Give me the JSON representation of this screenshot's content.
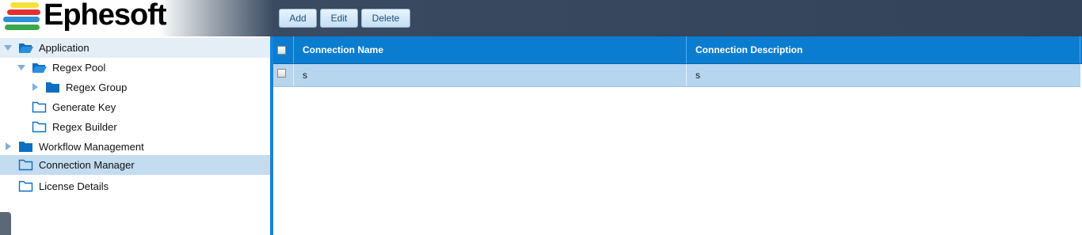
{
  "header": {
    "logo_text": "Ephesoft",
    "toolbar": {
      "add_label": "Add",
      "edit_label": "Edit",
      "delete_label": "Delete"
    }
  },
  "sidebar": {
    "items": [
      {
        "label": "Application",
        "icon": "folder-open-icon",
        "expanded": true
      },
      {
        "label": "Regex Pool",
        "icon": "folder-open-icon",
        "expanded": true
      },
      {
        "label": "Regex Group",
        "icon": "folder-filled-icon",
        "expanded": false
      },
      {
        "label": "Generate Key",
        "icon": "folder-outline-icon"
      },
      {
        "label": "Regex Builder",
        "icon": "folder-outline-icon"
      },
      {
        "label": "Workflow Management",
        "icon": "folder-filled-icon",
        "expanded": false
      },
      {
        "label": "Connection Manager",
        "icon": "folder-outline-icon",
        "selected": true
      },
      {
        "label": "License Details",
        "icon": "folder-outline-icon"
      }
    ]
  },
  "grid": {
    "columns": [
      "Connection Name",
      "Connection Description"
    ],
    "rows": [
      {
        "name": "s",
        "description": "s"
      }
    ]
  },
  "colors": {
    "header_dark": "#33435a",
    "grid_header": "#0a7dd1",
    "row_selected": "#b6d5ee",
    "sidebar_selected": "#c3dcf0",
    "button_bg": "#c5def3"
  }
}
